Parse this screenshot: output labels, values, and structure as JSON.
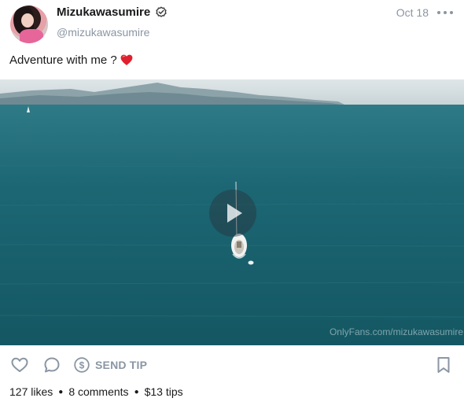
{
  "post": {
    "author": {
      "display_name": "Mizukawasumire",
      "handle": "@mizukawasumire",
      "verified": true
    },
    "date": "Oct 18",
    "caption": "Adventure with me ?",
    "caption_emoji": "red-heart",
    "media": {
      "type": "video",
      "watermark": "OnlyFans.com/mizukawasumire"
    },
    "actions": {
      "tip_label": "SEND TIP"
    },
    "stats": {
      "likes": "127 likes",
      "comments": "8 comments",
      "tips": "$13 tips"
    }
  },
  "colors": {
    "muted": "#8a96a3",
    "text": "#1a1a1a",
    "sea": "#17606d",
    "heart": "#e0202e"
  },
  "icons": [
    "verified-badge-icon",
    "more-icon",
    "heart-emoji-icon",
    "play-icon",
    "like-icon",
    "comment-icon",
    "dollar-icon",
    "bookmark-icon"
  ]
}
